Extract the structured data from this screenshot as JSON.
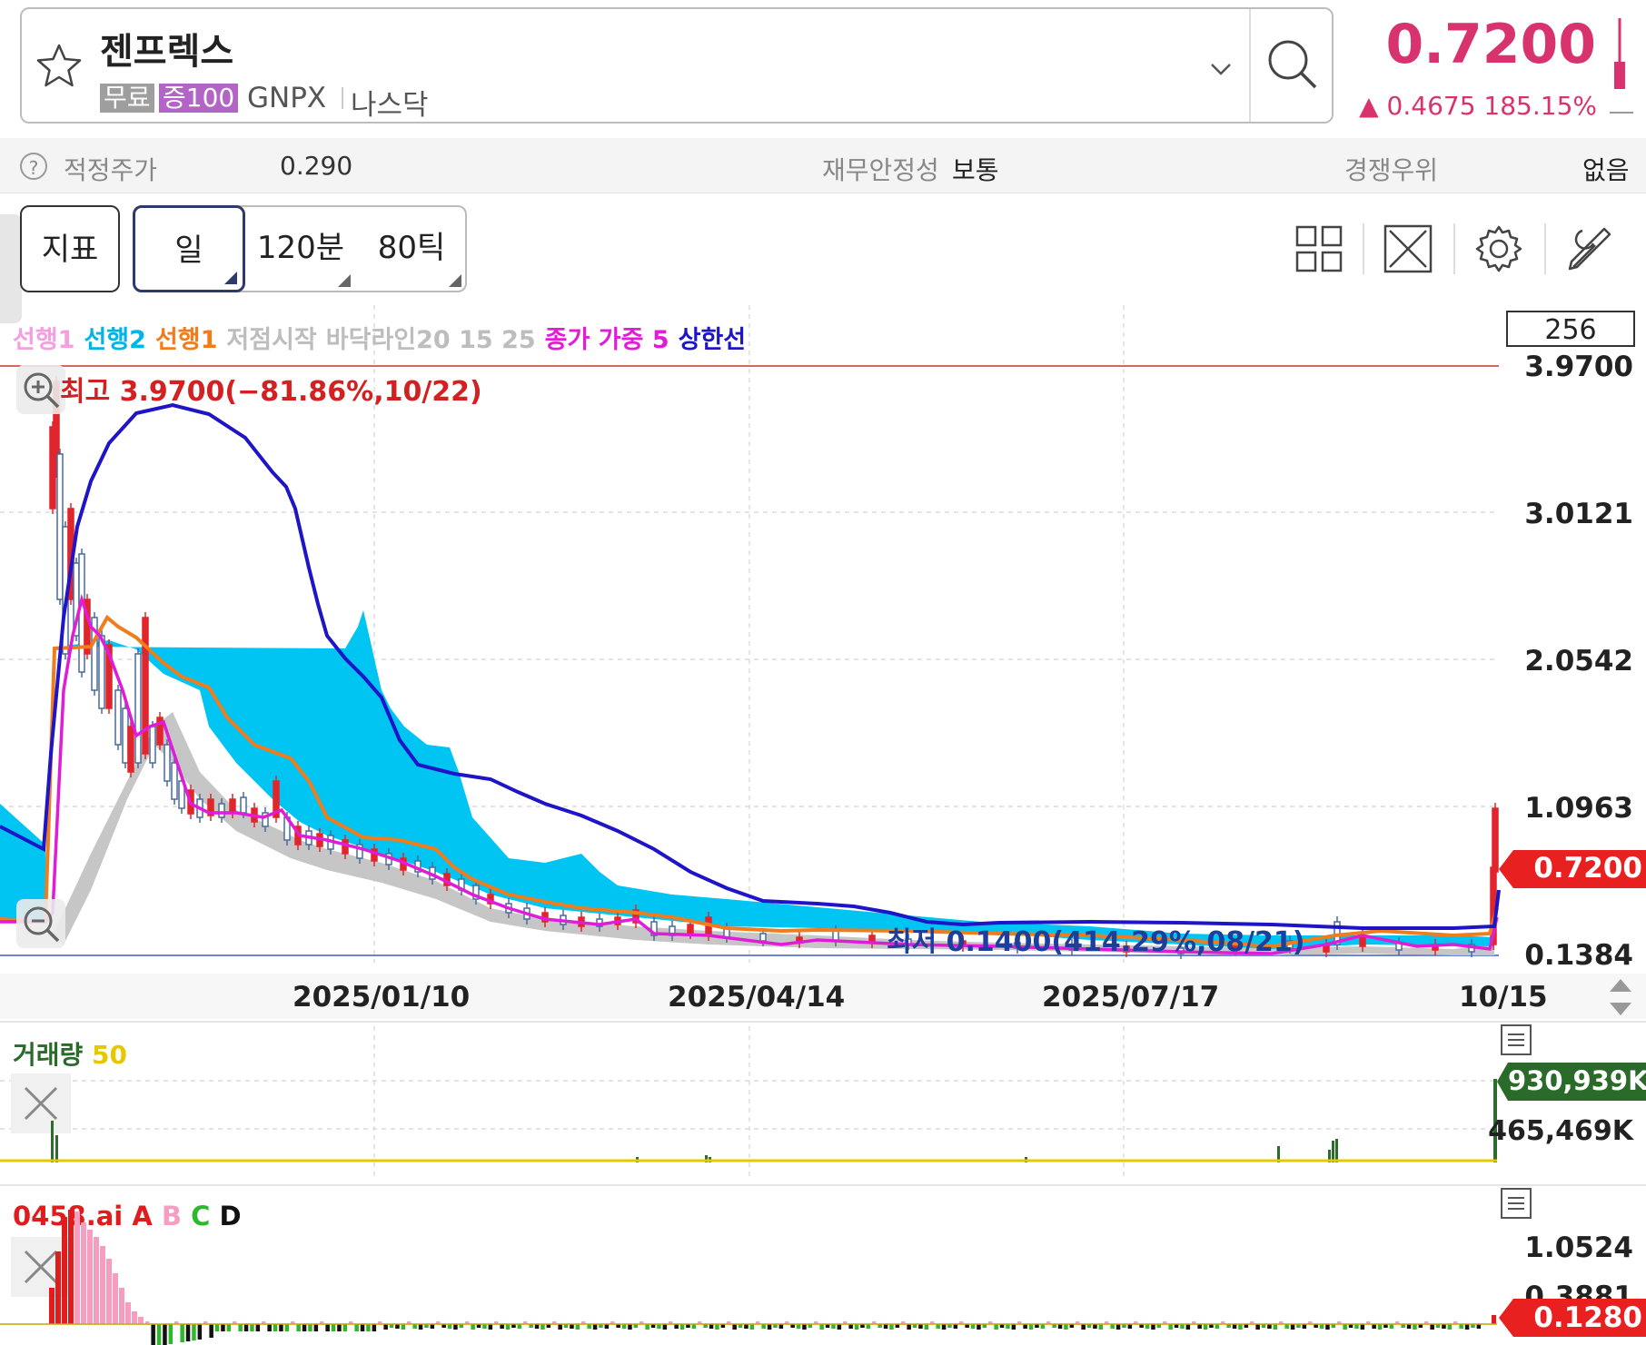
{
  "header": {
    "stock_name": "젠프렉스",
    "tag_free": "무료",
    "tag_margin": "증100",
    "ticker": "GNPX",
    "market": "나스닥",
    "price": "0.7200",
    "change": "▲ 0.4675  185.15%"
  },
  "info": {
    "fair_price_label": "적정주가",
    "fair_price_value": "0.290",
    "stability_label": "재무안정성",
    "stability_value": "보통",
    "competition_label": "경쟁우위",
    "competition_value": "없음"
  },
  "toolbar": {
    "indicator_label": "지표",
    "day_label": "일",
    "min120_label": "120분",
    "tick80_label": "80틱"
  },
  "legend": {
    "l1": "선행1",
    "l2": "선행2",
    "l3": "선행1",
    "l4": "저점시작",
    "l5": "바닥라인20 15 25",
    "l6": "종가 가중 5",
    "l7": "상한선"
  },
  "colors": {
    "up": "#e0262c",
    "down_fill": "#ffffff",
    "cloud": "#00c4f2",
    "orange": "#f07c1c",
    "upper": "#1e14c8",
    "magenta": "#e01cd8",
    "gray_band": "#bdbdbd",
    "price_tag": "#e8201f"
  },
  "chart": {
    "scale_value": "256",
    "high_label": "최고 3.9700(−81.86%,10/22)",
    "low_label": "최저 0.1400(414.29%,08/21)",
    "y_labels": [
      "3.9700",
      "3.0121",
      "2.0542",
      "1.0963",
      "0.1384"
    ],
    "current_price_tag": "0.7200",
    "x_labels": [
      "2025/01/10",
      "2025/04/14",
      "2025/07/17",
      "10/15"
    ]
  },
  "volume": {
    "title": "거래량",
    "period": "50",
    "max_tag": "930,939K",
    "mid_label": "465,469K"
  },
  "ai": {
    "title": "0458.ai",
    "a": "A",
    "b": "B",
    "c": "C",
    "d": "D",
    "y_top": "1.0524",
    "y_mid": "0.3881",
    "tag": "0.1280"
  },
  "chart_data": {
    "type": "candlestick",
    "ylim": [
      0.1384,
      3.97
    ],
    "x_ticks": [
      "2025/01/10",
      "2025/04/14",
      "2025/07/17",
      "10/15"
    ],
    "upper_line": [
      0.92,
      0.85,
      2.0,
      3.4,
      3.8,
      3.85,
      3.75,
      3.5,
      3.2,
      2.55,
      1.9,
      1.55,
      1.25,
      1.2,
      1.1,
      0.85,
      0.6,
      0.42,
      0.34,
      0.32,
      0.28,
      0.27,
      0.27,
      0.27,
      0.27,
      0.27,
      0.26,
      0.26,
      0.26,
      0.26,
      0.45
    ],
    "ma_close": [
      0.3,
      0.3,
      1.7,
      1.9,
      1.7,
      1.5,
      1.2,
      1.0,
      0.95,
      0.85,
      0.7,
      0.6,
      0.5,
      0.4,
      0.3,
      0.25,
      0.22,
      0.2,
      0.18,
      0.16,
      0.15,
      0.14,
      0.15,
      0.2,
      0.18,
      0.16,
      0.15,
      0.15,
      0.16,
      0.18,
      0.7
    ]
  }
}
